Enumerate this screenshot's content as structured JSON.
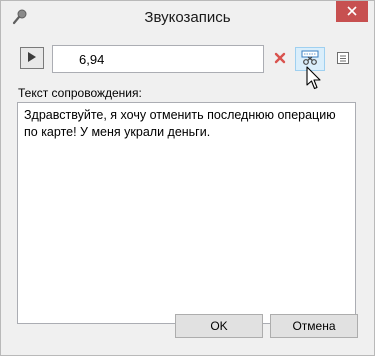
{
  "window": {
    "title": "Звукозапись"
  },
  "recording": {
    "value": "6,94"
  },
  "caption": {
    "label": "Текст сопровождения:",
    "text": "Здравствуйте, я хочу отменить последнюю операцию\nпо карте! У меня украли деньги."
  },
  "buttons": {
    "ok": "OK",
    "cancel": "Отмена"
  },
  "icons": {
    "title": "microphone-icon",
    "close": "close-icon",
    "play": "play-icon",
    "delete": "delete-x-icon",
    "cut": "scissors-icon",
    "document": "document-icon",
    "cursor": "mouse-pointer"
  },
  "colors": {
    "close_bg": "#c75050",
    "delete_red": "#d9534f",
    "cut_highlight": "#daeefb"
  }
}
